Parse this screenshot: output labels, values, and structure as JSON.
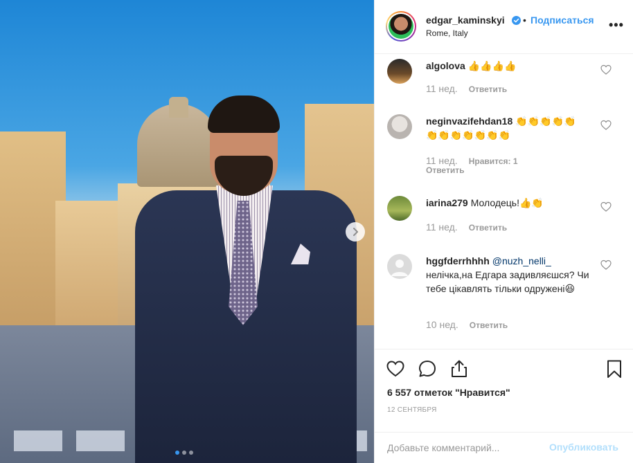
{
  "post": {
    "username": "edgar_kaminskyi",
    "bullet": "•",
    "follow_label": "Подписаться",
    "location": "Rome, Italy",
    "more_label": "•••"
  },
  "carousel": {
    "current_index": 1,
    "total": 3
  },
  "comments": [
    {
      "user": "algolova",
      "text": "👍👍👍👍",
      "time": "11 нед.",
      "reply": "Ответить",
      "likes": ""
    },
    {
      "user": "neginvazifehdan18",
      "text": "👏👏👏👏👏👏👏👏👏👏👏👏",
      "time": "11 нед.",
      "likes": "Нравится: 1",
      "reply": "Ответить"
    },
    {
      "user": "iarina279",
      "text": "Молодець!👍👏",
      "time": "11 нед.",
      "reply": "Ответить",
      "likes": ""
    },
    {
      "user": "hggfderrhhhh",
      "mention": "@nuzh_nelli_",
      "text": "нелічка,на Едгара задивляєшся? Чи тебе цікавлять тільки одружені😆",
      "time": "10 нед.",
      "reply": "Ответить",
      "likes": ""
    }
  ],
  "likes_text": "6 557 отметок \"Нравится\"",
  "date": "12 сентября",
  "comment_box": {
    "placeholder": "Добавьте комментарий...",
    "publish_label": "Опубликовать"
  },
  "colors": {
    "accent": "#3897f0",
    "publish_disabled": "#b2dffc",
    "muted": "#999999"
  },
  "icons": [
    "verified-badge-icon",
    "chevron-right-icon",
    "heart-icon",
    "comment-icon",
    "share-icon",
    "bookmark-icon",
    "more-icon"
  ]
}
